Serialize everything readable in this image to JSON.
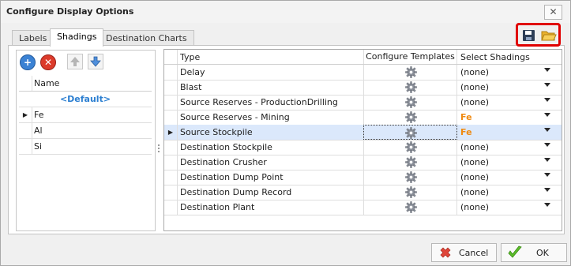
{
  "window": {
    "title": "Configure Display Options",
    "close_glyph": "✕"
  },
  "tabs": [
    {
      "label": "Labels",
      "active": false
    },
    {
      "label": "Shadings",
      "active": true
    },
    {
      "label": "Destination Charts",
      "active": false
    }
  ],
  "toolbar": {
    "save_icon": "save-icon",
    "open_icon": "open-folder-icon",
    "highlight_color": "#e00000"
  },
  "left_panel": {
    "buttons": [
      "add-icon",
      "remove-icon",
      "move-up-icon",
      "move-down-icon"
    ],
    "column_header": "Name",
    "rows": [
      {
        "name": "<Default>",
        "current": false
      },
      {
        "name": "Fe",
        "current": true
      },
      {
        "name": "Al",
        "current": false
      },
      {
        "name": "Si",
        "current": false
      }
    ]
  },
  "grid": {
    "columns": {
      "type": "Type",
      "configure": "Configure Templates",
      "select": "Select Shadings"
    },
    "rows": [
      {
        "type": "Delay",
        "shading": "(none)",
        "selected": false
      },
      {
        "type": "Blast",
        "shading": "(none)",
        "selected": false
      },
      {
        "type": "Source Reserves - ProductionDrilling",
        "shading": "(none)",
        "selected": false
      },
      {
        "type": "Source Reserves - Mining",
        "shading": "Fe",
        "selected": false
      },
      {
        "type": "Source Stockpile",
        "shading": "Fe",
        "selected": true
      },
      {
        "type": "Destination Stockpile",
        "shading": "(none)",
        "selected": false
      },
      {
        "type": "Destination Crusher",
        "shading": "(none)",
        "selected": false
      },
      {
        "type": "Destination Dump Point",
        "shading": "(none)",
        "selected": false
      },
      {
        "type": "Destination Dump Record",
        "shading": "(none)",
        "selected": false
      },
      {
        "type": "Destination Plant",
        "shading": "(none)",
        "selected": false
      }
    ],
    "highlight_color": "#ef8a12",
    "selected_row_color": "#dbe8fb"
  },
  "footer": {
    "cancel_label": "Cancel",
    "ok_label": "OK"
  }
}
